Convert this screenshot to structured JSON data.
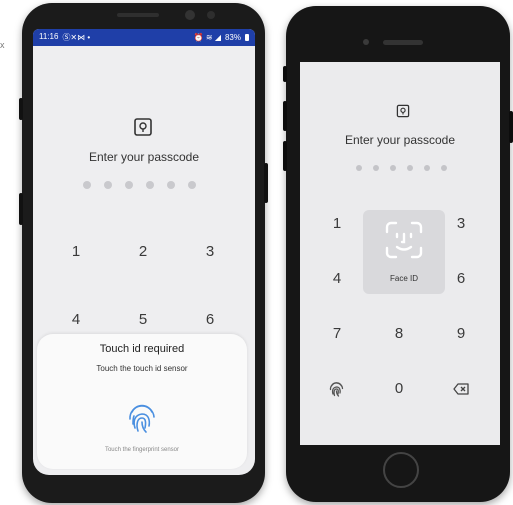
{
  "stray_mark": "x",
  "android": {
    "status_bar": {
      "time": "11:16",
      "left_icons": "Ⓢ✕⋈ •",
      "right_icons": "⏰ ≋ ◢",
      "battery": "83%"
    },
    "lock_icon": "lock-icon",
    "title": "Enter your passcode",
    "keypad": {
      "r1": [
        "1",
        "2",
        "3"
      ],
      "r2": [
        "4",
        "5",
        "6"
      ]
    },
    "sheet": {
      "title": "Touch id required",
      "subtitle": "Touch the touch id sensor",
      "icon": "fingerprint-icon",
      "hint": "Touch the fingerprint sensor"
    }
  },
  "iphone": {
    "lock_icon": "lock-icon",
    "title": "Enter your passcode",
    "faceid": {
      "label": "Face ID",
      "icon": "face-id-icon"
    },
    "keypad": {
      "r1": [
        "1",
        "3"
      ],
      "r2": [
        "4",
        "6"
      ],
      "r3": [
        "7",
        "8",
        "9"
      ],
      "r4": {
        "left_icon": "fingerprint-icon",
        "zero": "0",
        "right_icon": "backspace-icon"
      }
    }
  },
  "colors": {
    "status_bar": "#1f3fa8",
    "screen_bg": "#eeeef0",
    "fingerprint": "#4a8fe0"
  }
}
